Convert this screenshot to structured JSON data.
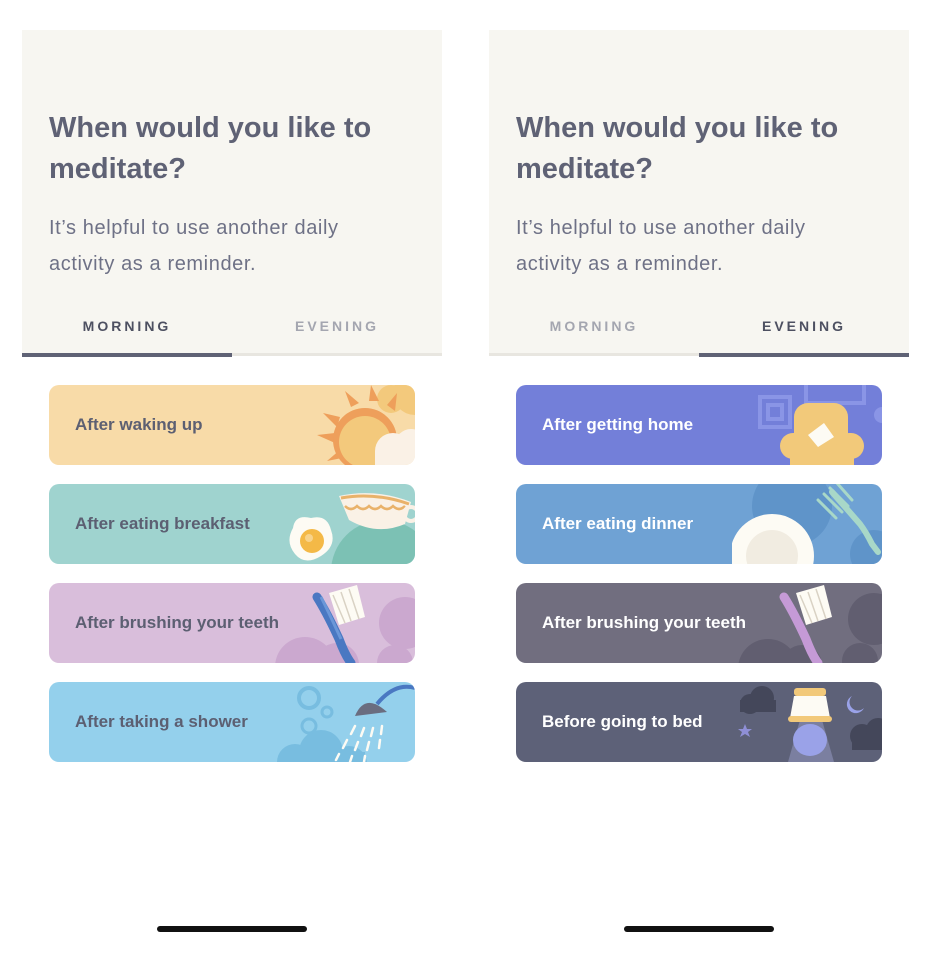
{
  "screens": [
    {
      "title": "When would you like to meditate?",
      "subtitle": "It’s helpful to use another daily activity as a reminder.",
      "tabs": [
        {
          "label": "MORNING",
          "active": true
        },
        {
          "label": "EVENING",
          "active": false
        }
      ],
      "options": [
        {
          "label": "After waking up",
          "bg": "#f8dba8",
          "text_color": "#5c5f72",
          "icon": "sun-icon"
        },
        {
          "label": "After eating breakfast",
          "bg": "#9fd3cf",
          "text_color": "#5c5f72",
          "icon": "breakfast-icon"
        },
        {
          "label": "After brushing your teeth",
          "bg": "#d9bedb",
          "text_color": "#5c5f72",
          "icon": "toothbrush-icon"
        },
        {
          "label": "After taking a shower",
          "bg": "#94d0ec",
          "text_color": "#5c5f72",
          "icon": "shower-icon"
        }
      ]
    },
    {
      "title": "When would you like to meditate?",
      "subtitle": "It’s helpful to use another daily activity as a reminder.",
      "tabs": [
        {
          "label": "MORNING",
          "active": false
        },
        {
          "label": "EVENING",
          "active": true
        }
      ],
      "options": [
        {
          "label": "After getting home",
          "bg": "#737fd9",
          "text_color": "#ffffff",
          "icon": "armchair-icon"
        },
        {
          "label": "After eating dinner",
          "bg": "#6fa2d4",
          "text_color": "#ffffff",
          "icon": "dinner-plate-icon"
        },
        {
          "label": "After brushing your teeth",
          "bg": "#716e7f",
          "text_color": "#ffffff",
          "icon": "toothbrush-icon"
        },
        {
          "label": "Before going to bed",
          "bg": "#5d6178",
          "text_color": "#ffffff",
          "icon": "lamp-icon"
        }
      ]
    }
  ],
  "colors": {
    "header_bg": "#f7f6f1",
    "title": "#5f6275",
    "tab_active": "#4d5061",
    "tab_inactive": "#a4a6b0",
    "underline": "#5f6275"
  }
}
